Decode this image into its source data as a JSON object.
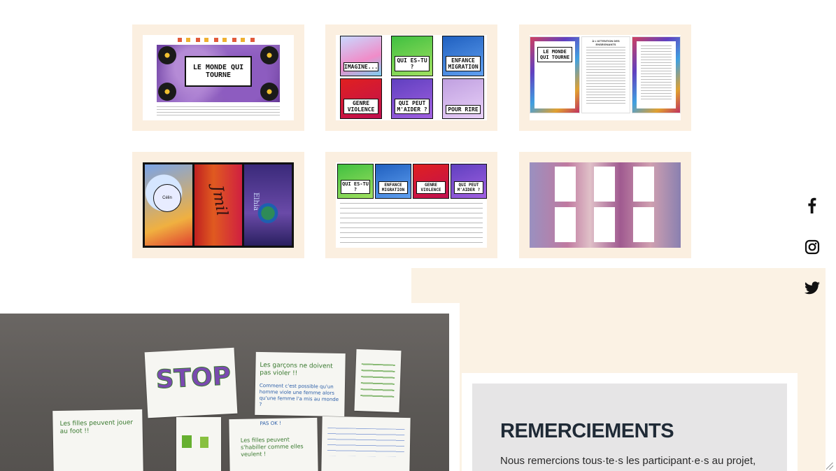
{
  "gallery": {
    "tile1": {
      "cover_title": "LE MONDE QUI TOURNE"
    },
    "tile2": {
      "cards": [
        "IMAGINE...",
        "QUI ES-TU ?",
        "ENFANCE MIGRATION",
        "GENRE VIOLENCE",
        "QUI PEUT M'AIDER ?",
        "POUR RIRE"
      ]
    },
    "tile3": {
      "page_title": "LE MONDE QUI TOURNE",
      "section_heading": "À L'ATTENTION DES ENSEIGNANTS"
    },
    "tile4": {
      "bookmark_labels": [
        "Célin",
        "Jmil",
        "Elhia"
      ]
    },
    "tile5": {
      "cards": [
        "QUI ES-TU ?",
        "ENFANCE MIGRATION",
        "GENRE VIOLENCE",
        "QUI PEUT M'AIDER ?"
      ]
    },
    "tile6": {}
  },
  "photo": {
    "poster_stop": "STOP",
    "poster_garcons": "Les garçons ne doivent pas violer !!",
    "poster_comment": "Comment c'est possible qu'un homme viole une femme alors qu'une femme l'a mis au monde ?",
    "poster_filles_foot": "Les filles peuvent jouer au foot !!",
    "poster_habiller": "Les filles peuvent s'habiller comme elles veulent !",
    "poster_pas_ok": "PAS OK !"
  },
  "social": {
    "facebook": "f",
    "instagram": "instagram",
    "twitter": "twitter"
  },
  "thanks": {
    "title": "REMERCIEMENTS",
    "text": "Nous remercions tous·te·s les participant·e·s au projet,"
  },
  "colors": {
    "tile_bg": "#fbefe0",
    "panel_bg": "#fbf2e4",
    "card_bg": "#e6e5e6",
    "title_color": "#1f2a36"
  }
}
